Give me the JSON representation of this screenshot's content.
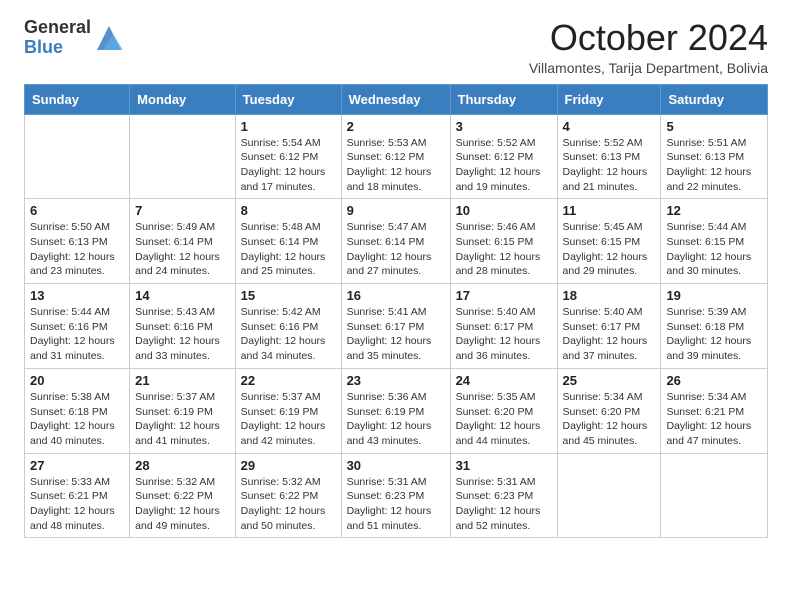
{
  "header": {
    "logo_general": "General",
    "logo_blue": "Blue",
    "month_title": "October 2024",
    "subtitle": "Villamontes, Tarija Department, Bolivia"
  },
  "weekdays": [
    "Sunday",
    "Monday",
    "Tuesday",
    "Wednesday",
    "Thursday",
    "Friday",
    "Saturday"
  ],
  "weeks": [
    [
      {
        "day": "",
        "info": ""
      },
      {
        "day": "",
        "info": ""
      },
      {
        "day": "1",
        "info": "Sunrise: 5:54 AM\nSunset: 6:12 PM\nDaylight: 12 hours and 17 minutes."
      },
      {
        "day": "2",
        "info": "Sunrise: 5:53 AM\nSunset: 6:12 PM\nDaylight: 12 hours and 18 minutes."
      },
      {
        "day": "3",
        "info": "Sunrise: 5:52 AM\nSunset: 6:12 PM\nDaylight: 12 hours and 19 minutes."
      },
      {
        "day": "4",
        "info": "Sunrise: 5:52 AM\nSunset: 6:13 PM\nDaylight: 12 hours and 21 minutes."
      },
      {
        "day": "5",
        "info": "Sunrise: 5:51 AM\nSunset: 6:13 PM\nDaylight: 12 hours and 22 minutes."
      }
    ],
    [
      {
        "day": "6",
        "info": "Sunrise: 5:50 AM\nSunset: 6:13 PM\nDaylight: 12 hours and 23 minutes."
      },
      {
        "day": "7",
        "info": "Sunrise: 5:49 AM\nSunset: 6:14 PM\nDaylight: 12 hours and 24 minutes."
      },
      {
        "day": "8",
        "info": "Sunrise: 5:48 AM\nSunset: 6:14 PM\nDaylight: 12 hours and 25 minutes."
      },
      {
        "day": "9",
        "info": "Sunrise: 5:47 AM\nSunset: 6:14 PM\nDaylight: 12 hours and 27 minutes."
      },
      {
        "day": "10",
        "info": "Sunrise: 5:46 AM\nSunset: 6:15 PM\nDaylight: 12 hours and 28 minutes."
      },
      {
        "day": "11",
        "info": "Sunrise: 5:45 AM\nSunset: 6:15 PM\nDaylight: 12 hours and 29 minutes."
      },
      {
        "day": "12",
        "info": "Sunrise: 5:44 AM\nSunset: 6:15 PM\nDaylight: 12 hours and 30 minutes."
      }
    ],
    [
      {
        "day": "13",
        "info": "Sunrise: 5:44 AM\nSunset: 6:16 PM\nDaylight: 12 hours and 31 minutes."
      },
      {
        "day": "14",
        "info": "Sunrise: 5:43 AM\nSunset: 6:16 PM\nDaylight: 12 hours and 33 minutes."
      },
      {
        "day": "15",
        "info": "Sunrise: 5:42 AM\nSunset: 6:16 PM\nDaylight: 12 hours and 34 minutes."
      },
      {
        "day": "16",
        "info": "Sunrise: 5:41 AM\nSunset: 6:17 PM\nDaylight: 12 hours and 35 minutes."
      },
      {
        "day": "17",
        "info": "Sunrise: 5:40 AM\nSunset: 6:17 PM\nDaylight: 12 hours and 36 minutes."
      },
      {
        "day": "18",
        "info": "Sunrise: 5:40 AM\nSunset: 6:17 PM\nDaylight: 12 hours and 37 minutes."
      },
      {
        "day": "19",
        "info": "Sunrise: 5:39 AM\nSunset: 6:18 PM\nDaylight: 12 hours and 39 minutes."
      }
    ],
    [
      {
        "day": "20",
        "info": "Sunrise: 5:38 AM\nSunset: 6:18 PM\nDaylight: 12 hours and 40 minutes."
      },
      {
        "day": "21",
        "info": "Sunrise: 5:37 AM\nSunset: 6:19 PM\nDaylight: 12 hours and 41 minutes."
      },
      {
        "day": "22",
        "info": "Sunrise: 5:37 AM\nSunset: 6:19 PM\nDaylight: 12 hours and 42 minutes."
      },
      {
        "day": "23",
        "info": "Sunrise: 5:36 AM\nSunset: 6:19 PM\nDaylight: 12 hours and 43 minutes."
      },
      {
        "day": "24",
        "info": "Sunrise: 5:35 AM\nSunset: 6:20 PM\nDaylight: 12 hours and 44 minutes."
      },
      {
        "day": "25",
        "info": "Sunrise: 5:34 AM\nSunset: 6:20 PM\nDaylight: 12 hours and 45 minutes."
      },
      {
        "day": "26",
        "info": "Sunrise: 5:34 AM\nSunset: 6:21 PM\nDaylight: 12 hours and 47 minutes."
      }
    ],
    [
      {
        "day": "27",
        "info": "Sunrise: 5:33 AM\nSunset: 6:21 PM\nDaylight: 12 hours and 48 minutes."
      },
      {
        "day": "28",
        "info": "Sunrise: 5:32 AM\nSunset: 6:22 PM\nDaylight: 12 hours and 49 minutes."
      },
      {
        "day": "29",
        "info": "Sunrise: 5:32 AM\nSunset: 6:22 PM\nDaylight: 12 hours and 50 minutes."
      },
      {
        "day": "30",
        "info": "Sunrise: 5:31 AM\nSunset: 6:23 PM\nDaylight: 12 hours and 51 minutes."
      },
      {
        "day": "31",
        "info": "Sunrise: 5:31 AM\nSunset: 6:23 PM\nDaylight: 12 hours and 52 minutes."
      },
      {
        "day": "",
        "info": ""
      },
      {
        "day": "",
        "info": ""
      }
    ]
  ]
}
